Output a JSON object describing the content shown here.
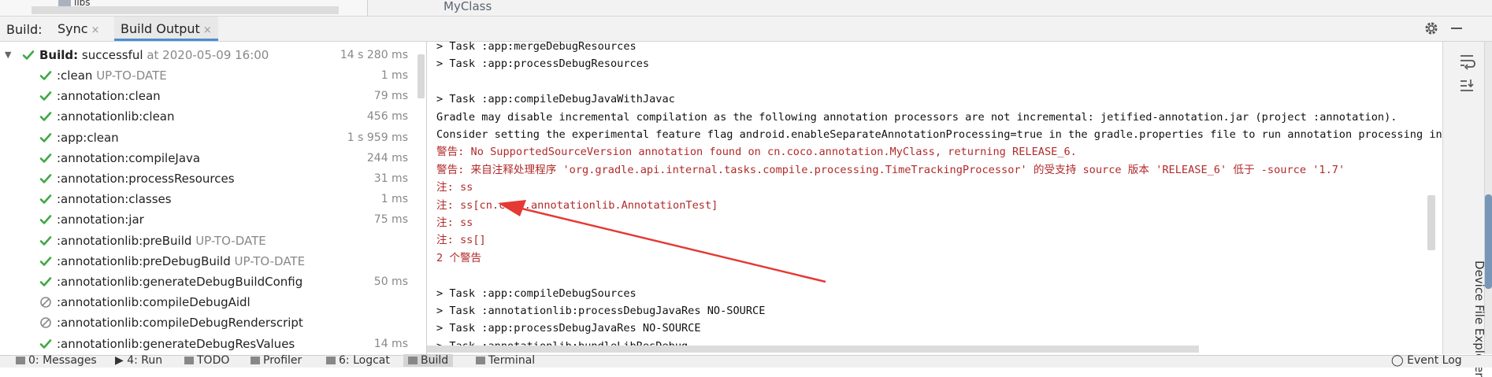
{
  "top": {
    "folder_label": "libs",
    "class_label": "MyClass"
  },
  "toolbar": {
    "build_label": "Build:",
    "tabs": [
      {
        "label": "Sync",
        "close": "×"
      },
      {
        "label": "Build Output",
        "close": "×"
      }
    ]
  },
  "tree": {
    "root": {
      "label": "Build:",
      "value": "successful",
      "suffix": "at 2020-05-09 16:00",
      "time": "14 s 280 ms"
    },
    "items": [
      {
        "name": ":clean",
        "status": "UP-TO-DATE",
        "time": "1 ms",
        "icon": "check"
      },
      {
        "name": ":annotation:clean",
        "status": "",
        "time": "79 ms",
        "icon": "check"
      },
      {
        "name": ":annotationlib:clean",
        "status": "",
        "time": "456 ms",
        "icon": "check"
      },
      {
        "name": ":app:clean",
        "status": "",
        "time": "1 s 959 ms",
        "icon": "check"
      },
      {
        "name": ":annotation:compileJava",
        "status": "",
        "time": "244 ms",
        "icon": "check"
      },
      {
        "name": ":annotation:processResources",
        "status": "",
        "time": "31 ms",
        "icon": "check"
      },
      {
        "name": ":annotation:classes",
        "status": "",
        "time": "1 ms",
        "icon": "check"
      },
      {
        "name": ":annotation:jar",
        "status": "",
        "time": "75 ms",
        "icon": "check"
      },
      {
        "name": ":annotationlib:preBuild",
        "status": "UP-TO-DATE",
        "time": "",
        "icon": "check"
      },
      {
        "name": ":annotationlib:preDebugBuild",
        "status": "UP-TO-DATE",
        "time": "",
        "icon": "check"
      },
      {
        "name": ":annotationlib:generateDebugBuildConfig",
        "status": "",
        "time": "50 ms",
        "icon": "check"
      },
      {
        "name": ":annotationlib:compileDebugAidl",
        "status": "",
        "time": "",
        "icon": "skip"
      },
      {
        "name": ":annotationlib:compileDebugRenderscript",
        "status": "",
        "time": "",
        "icon": "skip"
      },
      {
        "name": ":annotationlib:generateDebugResValues",
        "status": "",
        "time": "14 ms",
        "icon": "check"
      }
    ]
  },
  "console": {
    "lines": [
      {
        "text": "> Task :app:mergeDebugResources",
        "kind": "normal"
      },
      {
        "text": "> Task :app:processDebugResources",
        "kind": "normal"
      },
      {
        "text": "",
        "kind": "normal"
      },
      {
        "text": "> Task :app:compileDebugJavaWithJavac",
        "kind": "normal"
      },
      {
        "text": "Gradle may disable incremental compilation as the following annotation processors are not incremental: jetified-annotation.jar (project :annotation).",
        "kind": "normal"
      },
      {
        "text": "Consider setting the experimental feature flag android.enableSeparateAnnotationProcessing=true in the gradle.properties file to run annotation processing in a s",
        "kind": "normal"
      },
      {
        "text": "警告: No SupportedSourceVersion annotation found on cn.coco.annotation.MyClass, returning RELEASE_6.",
        "kind": "warn"
      },
      {
        "text": "警告: 来自注释处理程序 'org.gradle.api.internal.tasks.compile.processing.TimeTrackingProcessor' 的受支持 source 版本 'RELEASE_6' 低于 -source '1.7'",
        "kind": "warn"
      },
      {
        "text": "注: ss",
        "kind": "warn"
      },
      {
        "text": "注: ss[cn.coco.annotationlib.AnnotationTest]",
        "kind": "warn"
      },
      {
        "text": "注: ss",
        "kind": "warn"
      },
      {
        "text": "注: ss[]",
        "kind": "warn"
      },
      {
        "text": "2 个警告",
        "kind": "warn"
      },
      {
        "text": "",
        "kind": "normal"
      },
      {
        "text": "> Task :app:compileDebugSources",
        "kind": "normal"
      },
      {
        "text": "> Task :annotationlib:processDebugJavaRes NO-SOURCE",
        "kind": "normal"
      },
      {
        "text": "> Task :app:processDebugJavaRes NO-SOURCE",
        "kind": "normal"
      },
      {
        "text": "> Task :annotationlib:bundleLibResDebug",
        "kind": "normal"
      }
    ]
  },
  "right_strip": {
    "label": "Device File Explorer"
  },
  "statusbar": {
    "items": [
      {
        "label": "0: Messages"
      },
      {
        "label": "4: Run"
      },
      {
        "label": "TODO"
      },
      {
        "label": "Profiler"
      },
      {
        "label": "6: Logcat"
      },
      {
        "label": "Build"
      },
      {
        "label": "Terminal"
      },
      {
        "label": "Event Log"
      }
    ]
  },
  "colors": {
    "check": "#3fa845",
    "warn_text": "#b22a2a",
    "annotation_arrow": "#e53935"
  }
}
